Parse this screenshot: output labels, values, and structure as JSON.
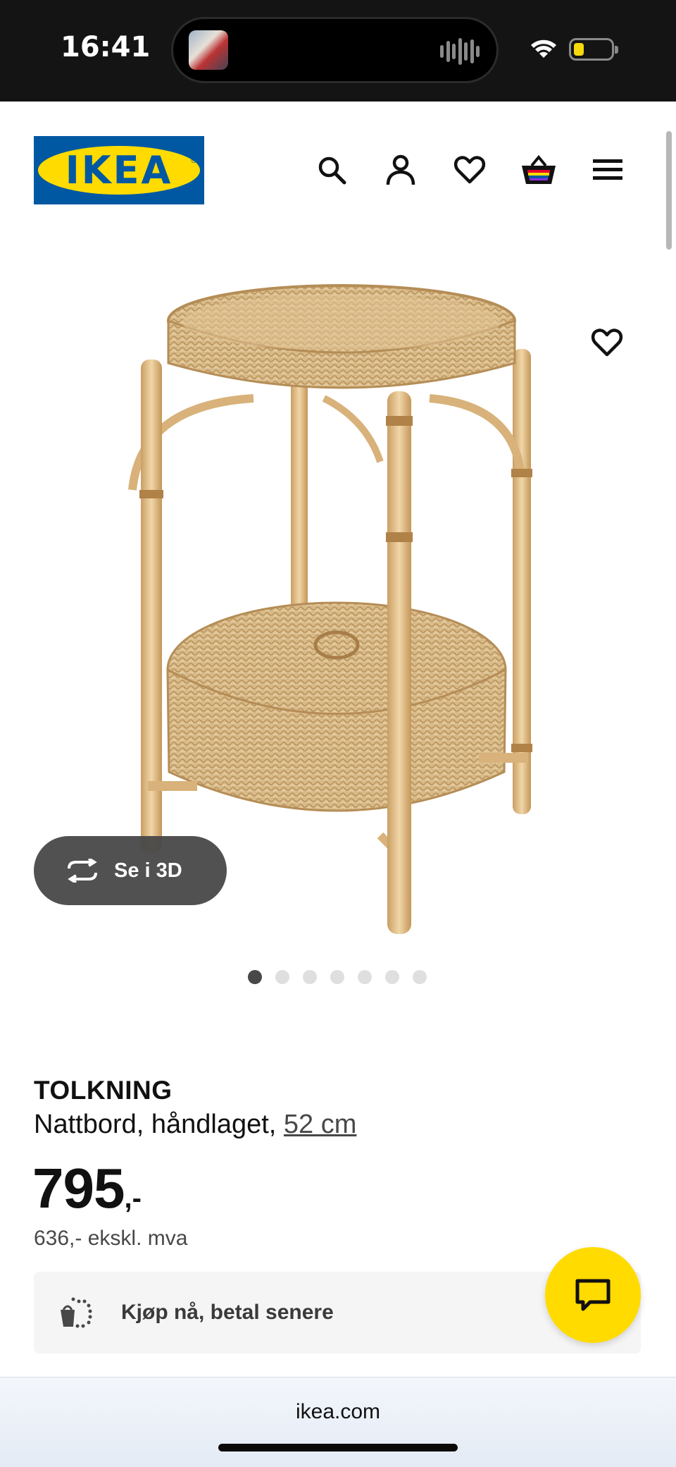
{
  "status_bar": {
    "time": "16:41",
    "battery_color": "#f5d90a"
  },
  "header": {
    "logo_text": "IKEA",
    "logo_colors": {
      "blue": "#0058a3",
      "yellow": "#ffdb00"
    },
    "icons": [
      "search-icon",
      "account-icon",
      "heart-icon",
      "cart-icon",
      "menu-icon"
    ]
  },
  "product": {
    "view_3d_label": "Se i 3D",
    "image_count": 7,
    "active_image": 1,
    "name": "TOLKNING",
    "description": "Nattbord, håndlaget, ",
    "size_link": "52 cm",
    "price": "795",
    "price_suffix": ",-",
    "price_ex_vat": "636,- ekskl. mva"
  },
  "bnpl": {
    "label": "Kjøp nå, betal senere"
  },
  "browser": {
    "url": "ikea.com"
  }
}
